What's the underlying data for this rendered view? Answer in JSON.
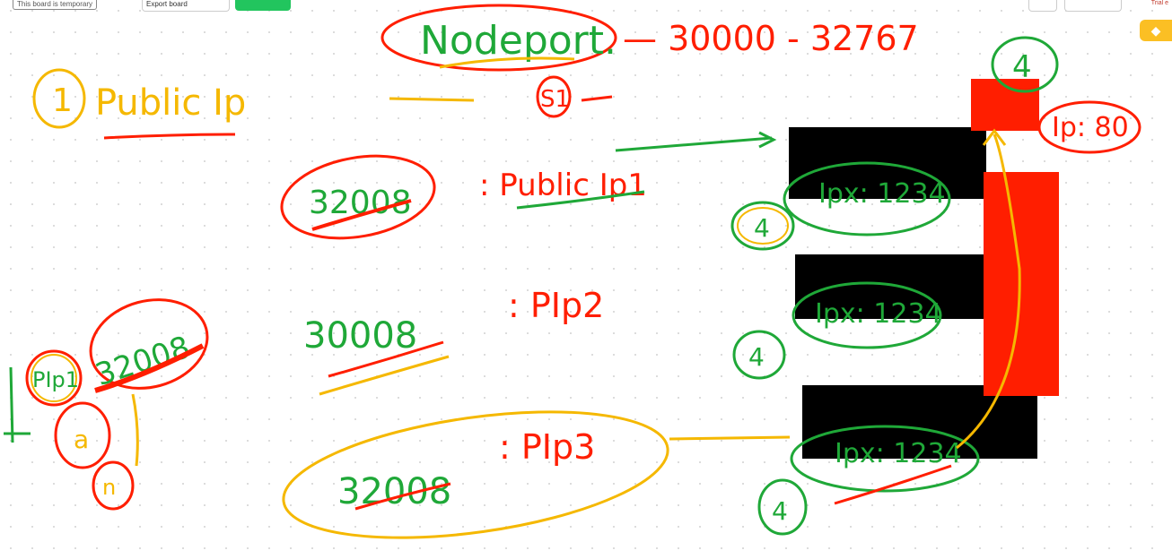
{
  "topbar": {
    "temp_notice": "This board is temporary",
    "export_label": "Export board",
    "trial_label": "Trial e"
  },
  "colors": {
    "red": "#ff1e00",
    "green": "#1fa838",
    "yellow": "#f5b800",
    "black": "#000000"
  },
  "board": {
    "title": "Nodeport.",
    "port_range": "— 30000 - 32767",
    "step_1": "1",
    "public_ip_heading": "Public Ip",
    "s1_label": "S1",
    "row1_port": "32008",
    "row1_target": ": Public Ip1",
    "row2_port": "30008",
    "row2_target": ": PIp2",
    "row3_port": "32008",
    "row3_target": ": PIp3",
    "node1_ip": "Ipx: 1234",
    "node2_ip": "Ipx: 1234",
    "node3_ip": "Ipx: 1234",
    "count_4": "4",
    "pod_ip": "Ip: 80",
    "side_pip": "PIp1",
    "side_port": "32008",
    "side_a": "a",
    "side_n": "n"
  }
}
